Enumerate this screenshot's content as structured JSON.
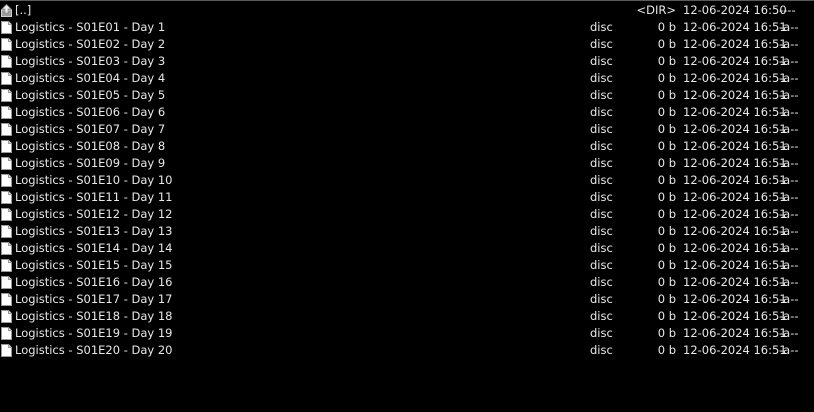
{
  "parent": {
    "name": "[..]",
    "size": "<DIR>",
    "date": "12-06-2024 16:50",
    "attr": "----"
  },
  "files": [
    {
      "name": "Logistics - S01E01 - Day 1",
      "ext": "disc",
      "size": "0 b",
      "date": "12-06-2024 16:51",
      "attr": "-a--"
    },
    {
      "name": "Logistics - S01E02 - Day 2",
      "ext": "disc",
      "size": "0 b",
      "date": "12-06-2024 16:51",
      "attr": "-a--"
    },
    {
      "name": "Logistics - S01E03 - Day 3",
      "ext": "disc",
      "size": "0 b",
      "date": "12-06-2024 16:51",
      "attr": "-a--"
    },
    {
      "name": "Logistics - S01E04 - Day 4",
      "ext": "disc",
      "size": "0 b",
      "date": "12-06-2024 16:51",
      "attr": "-a--"
    },
    {
      "name": "Logistics - S01E05 - Day 5",
      "ext": "disc",
      "size": "0 b",
      "date": "12-06-2024 16:51",
      "attr": "-a--"
    },
    {
      "name": "Logistics - S01E06 - Day 6",
      "ext": "disc",
      "size": "0 b",
      "date": "12-06-2024 16:51",
      "attr": "-a--"
    },
    {
      "name": "Logistics - S01E07 - Day 7",
      "ext": "disc",
      "size": "0 b",
      "date": "12-06-2024 16:51",
      "attr": "-a--"
    },
    {
      "name": "Logistics - S01E08 - Day 8",
      "ext": "disc",
      "size": "0 b",
      "date": "12-06-2024 16:51",
      "attr": "-a--"
    },
    {
      "name": "Logistics - S01E09 - Day 9",
      "ext": "disc",
      "size": "0 b",
      "date": "12-06-2024 16:51",
      "attr": "-a--"
    },
    {
      "name": "Logistics - S01E10 - Day 10",
      "ext": "disc",
      "size": "0 b",
      "date": "12-06-2024 16:51",
      "attr": "-a--"
    },
    {
      "name": "Logistics - S01E11 - Day 11",
      "ext": "disc",
      "size": "0 b",
      "date": "12-06-2024 16:51",
      "attr": "-a--"
    },
    {
      "name": "Logistics - S01E12 - Day 12",
      "ext": "disc",
      "size": "0 b",
      "date": "12-06-2024 16:51",
      "attr": "-a--"
    },
    {
      "name": "Logistics - S01E13 - Day 13",
      "ext": "disc",
      "size": "0 b",
      "date": "12-06-2024 16:51",
      "attr": "-a--"
    },
    {
      "name": "Logistics - S01E14 - Day 14",
      "ext": "disc",
      "size": "0 b",
      "date": "12-06-2024 16:51",
      "attr": "-a--"
    },
    {
      "name": "Logistics - S01E15 - Day 15",
      "ext": "disc",
      "size": "0 b",
      "date": "12-06-2024 16:51",
      "attr": "-a--"
    },
    {
      "name": "Logistics - S01E16 - Day 16",
      "ext": "disc",
      "size": "0 b",
      "date": "12-06-2024 16:51",
      "attr": "-a--"
    },
    {
      "name": "Logistics - S01E17 - Day 17",
      "ext": "disc",
      "size": "0 b",
      "date": "12-06-2024 16:51",
      "attr": "-a--"
    },
    {
      "name": "Logistics - S01E18 - Day 18",
      "ext": "disc",
      "size": "0 b",
      "date": "12-06-2024 16:51",
      "attr": "-a--"
    },
    {
      "name": "Logistics - S01E19 - Day 19",
      "ext": "disc",
      "size": "0 b",
      "date": "12-06-2024 16:51",
      "attr": "-a--"
    },
    {
      "name": "Logistics - S01E20 - Day 20",
      "ext": "disc",
      "size": "0 b",
      "date": "12-06-2024 16:51",
      "attr": "-a--"
    }
  ],
  "icons": {
    "parent": "up-folder-icon",
    "file": "file-icon"
  },
  "colors": {
    "background": "#000000",
    "text": "#e8e8e8"
  }
}
